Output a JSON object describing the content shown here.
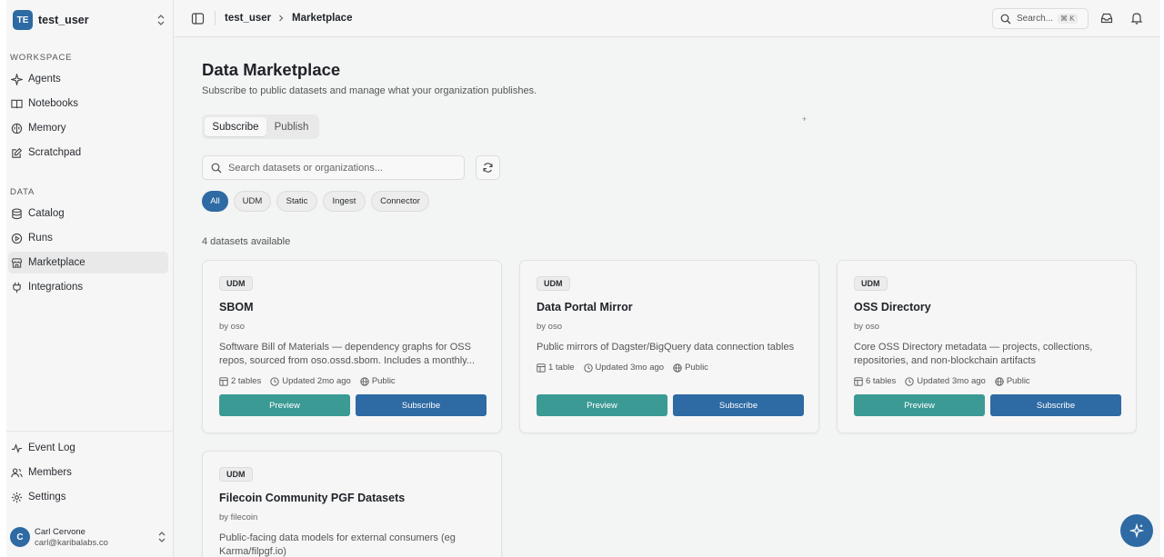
{
  "sidebar": {
    "user": {
      "initials": "TE",
      "name": "test_user"
    },
    "workspace_label": "WORKSPACE",
    "workspace_items": [
      {
        "label": "Agents",
        "icon": "sparkle-icon"
      },
      {
        "label": "Notebooks",
        "icon": "book-icon"
      },
      {
        "label": "Memory",
        "icon": "brain-icon"
      },
      {
        "label": "Scratchpad",
        "icon": "edit-icon"
      }
    ],
    "data_label": "DATA",
    "data_items": [
      {
        "label": "Catalog",
        "icon": "database-icon"
      },
      {
        "label": "Runs",
        "icon": "play-circle-icon"
      },
      {
        "label": "Marketplace",
        "icon": "store-icon",
        "active": true
      },
      {
        "label": "Integrations",
        "icon": "plug-icon"
      }
    ],
    "footer_items": [
      {
        "label": "Event Log",
        "icon": "activity-icon"
      },
      {
        "label": "Members",
        "icon": "users-icon"
      },
      {
        "label": "Settings",
        "icon": "gear-icon"
      }
    ],
    "account": {
      "initial": "C",
      "name": "Carl Cervone",
      "email": "carl@karibalabs.co"
    }
  },
  "topbar": {
    "breadcrumb": [
      "test_user",
      "Marketplace"
    ],
    "search_label": "Search...",
    "shortcut": "⌘ K"
  },
  "main": {
    "title": "Data Marketplace",
    "subtitle": "Subscribe to public datasets and manage what your organization publishes.",
    "tabs": [
      {
        "label": "Subscribe",
        "active": true
      },
      {
        "label": "Publish",
        "active": false
      }
    ],
    "search_placeholder": "Search datasets or organizations...",
    "filters": [
      {
        "label": "All",
        "active": true
      },
      {
        "label": "UDM"
      },
      {
        "label": "Static"
      },
      {
        "label": "Ingest"
      },
      {
        "label": "Connector"
      }
    ],
    "count_text": "4 datasets available",
    "cards": [
      {
        "badge": "UDM",
        "title": "SBOM",
        "owner": "by oso",
        "description": "Software Bill of Materials — dependency graphs for OSS repos, sourced from oso.ossd.sbom. Includes a monthly...",
        "tables": "2 tables",
        "updated": "Updated 2mo ago",
        "visibility": "Public",
        "preview_label": "Preview",
        "subscribe_label": "Subscribe"
      },
      {
        "badge": "UDM",
        "title": "Data Portal Mirror",
        "owner": "by oso",
        "description": "Public mirrors of Dagster/BigQuery data connection tables",
        "tables": "1 table",
        "updated": "Updated 3mo ago",
        "visibility": "Public",
        "preview_label": "Preview",
        "subscribe_label": "Subscribe"
      },
      {
        "badge": "UDM",
        "title": "OSS Directory",
        "owner": "by oso",
        "description": "Core OSS Directory metadata — projects, collections, repositories, and non-blockchain artifacts",
        "tables": "6 tables",
        "updated": "Updated 3mo ago",
        "visibility": "Public",
        "preview_label": "Preview",
        "subscribe_label": "Subscribe"
      },
      {
        "badge": "UDM",
        "title": "Filecoin Community PGF Datasets",
        "owner": "by filecoin",
        "description": "Public-facing data models for external consumers (eg Karma/filpgf.io)"
      }
    ]
  },
  "colors": {
    "accent": "#2e6aa3",
    "preview": "#3c9a95",
    "background": "#f3f4f4"
  }
}
